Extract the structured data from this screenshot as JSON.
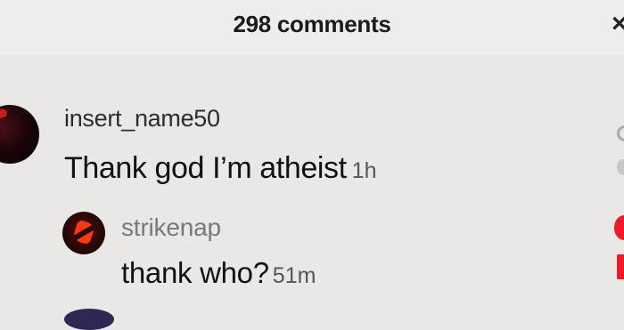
{
  "header": {
    "comment_count": "298 comments",
    "close_icon": "close-icon"
  },
  "comments": [
    {
      "username": "insert_name50",
      "text": "Thank god I’m atheist",
      "time": "1h",
      "avatar": "user-avatar",
      "reply": {
        "username": "strikenap",
        "text": "thank who?",
        "time": "51m",
        "avatar": "user-avatar"
      }
    }
  ],
  "colors": {
    "background": "#e9e8e6",
    "header_background": "#eeeded",
    "primary_text": "#111111",
    "secondary_text": "#7a7979",
    "like_active": "#ef1b28"
  }
}
